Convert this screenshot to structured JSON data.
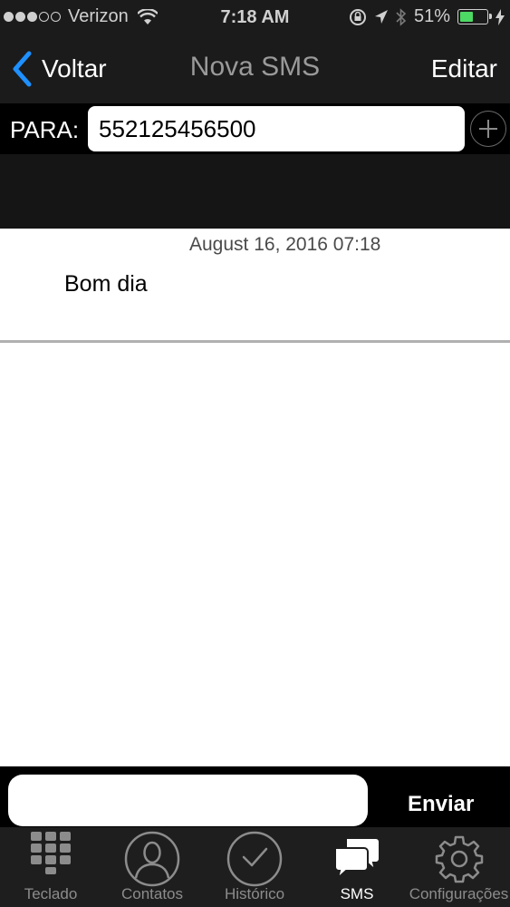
{
  "status_bar": {
    "carrier": "Verizon",
    "time": "7:18 AM",
    "battery_percent": "51%",
    "battery_level": 0.51,
    "icons": [
      "signal-dots",
      "wifi-icon",
      "lock-rotation-icon",
      "location-arrow-icon",
      "bluetooth-icon",
      "battery-icon",
      "charging-bolt-icon"
    ]
  },
  "nav": {
    "back_label": "Voltar",
    "title": "Nova SMS",
    "edit_label": "Editar",
    "accent_color": "#1e90ff"
  },
  "recipient": {
    "label": "PARA:",
    "value": "552125456500",
    "add_icon": "plus-circle-icon"
  },
  "messages": [
    {
      "date": "August 16, 2016 07:18",
      "text": "Bom dia"
    }
  ],
  "compose": {
    "value": "",
    "send_label": "Enviar"
  },
  "tabs": [
    {
      "label": "Teclado",
      "icon": "keypad-icon",
      "active": false
    },
    {
      "label": "Contatos",
      "icon": "contacts-icon",
      "active": false
    },
    {
      "label": "Histórico",
      "icon": "history-icon",
      "active": false
    },
    {
      "label": "SMS",
      "icon": "sms-icon",
      "active": true
    },
    {
      "label": "Configurações",
      "icon": "settings-gear-icon",
      "active": false
    }
  ]
}
